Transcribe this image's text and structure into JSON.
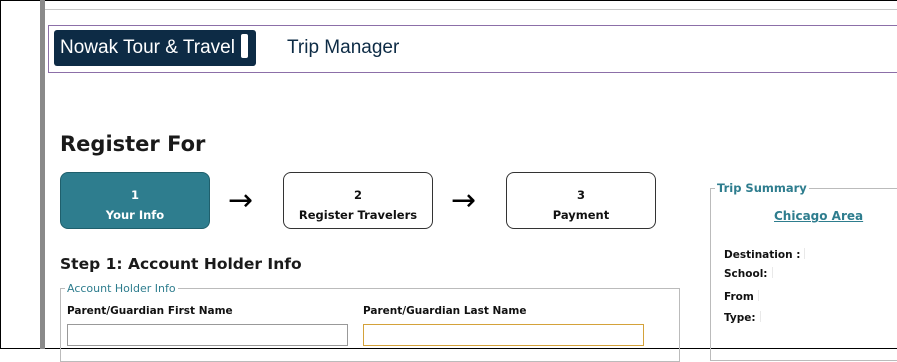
{
  "header": {
    "brand": "Nowak Tour & Travel",
    "app_title": "Trip Manager"
  },
  "page": {
    "title": "Register For"
  },
  "steps": [
    {
      "number": "1",
      "label": "Your Info",
      "active": true
    },
    {
      "number": "2",
      "label": "Register Travelers",
      "active": false
    },
    {
      "number": "3",
      "label": "Payment",
      "active": false
    }
  ],
  "step1": {
    "heading": "Step 1: Account Holder Info",
    "fieldset_legend": "Account Holder Info",
    "first_name_label": "Parent/Guardian First Name",
    "first_name_value": "",
    "last_name_label": "Parent/Guardian Last Name",
    "last_name_value": ""
  },
  "summary": {
    "legend": "Trip Summary",
    "trip_link": "Chicago Area",
    "destination_label": "Destination :",
    "destination_value": "",
    "school_label": "School:",
    "school_value": "",
    "from_label": "From",
    "from_value": "",
    "type_label": "Type:",
    "type_value": ""
  },
  "colors": {
    "brand_bg": "#0d2b45",
    "accent_teal": "#2e7d8e",
    "header_border": "#8c6fa8",
    "focus_border": "#d4a23a"
  }
}
